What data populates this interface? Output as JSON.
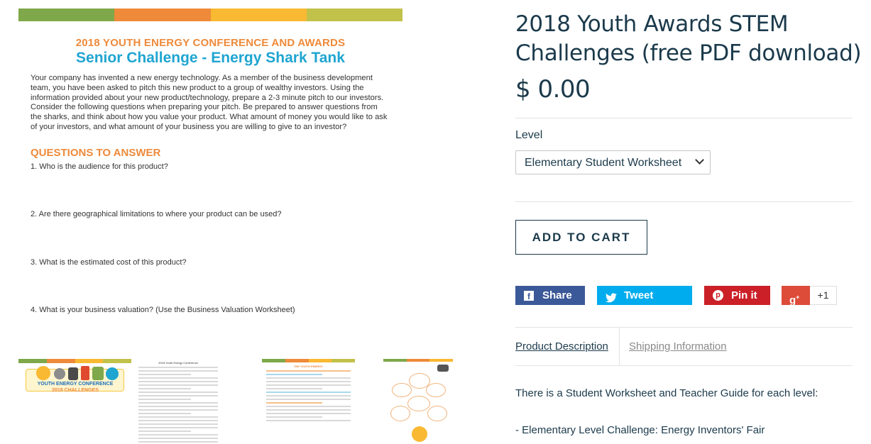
{
  "document_preview": {
    "stripe_colors": [
      "#7ea84a",
      "#ee8a3a",
      "#f9b932",
      "#c1c24a"
    ],
    "heading": "2018 YOUTH ENERGY CONFERENCE AND AWARDS",
    "subheading": "Senior Challenge - Energy Shark Tank",
    "body": "Your company has invented a new energy technology.  As a member of the business development team, you have been asked to pitch this new product to a group of wealthy investors.  Using the information provided about your new product/technology, prepare a 2-3 minute pitch to our investors.  Consider the following questions when preparing your pitch.  Be prepared to answer questions from the sharks, and think about how you value your product.  What amount of money you would like to ask of your investors, and what amount of your business you are willing to give to an investor?",
    "questions_heading": "QUESTIONS TO ANSWER",
    "questions": [
      "1.   Who is the audience for this product?",
      "2.   Are there geographical limitations to where your product can be used?",
      "3.   What is the estimated cost of this product?",
      "4.   What is your business valuation? (Use the Business Valuation Worksheet)"
    ]
  },
  "thumbnails": [
    {
      "line1": "YOUTH ENERGY CONFERENCE",
      "line2": "2018 CHALLENGES"
    },
    {
      "title": "2018 Youth Energy Conference"
    },
    {
      "title": "THE YOUTH ENERGY"
    },
    {
      "title": ""
    }
  ],
  "product": {
    "title": "2018 Youth Awards STEM Challenges (free PDF download)",
    "price": "$ 0.00",
    "level_label": "Level",
    "level_selected": "Elementary Student Worksheet",
    "add_to_cart": "ADD TO CART"
  },
  "social": {
    "facebook": "Share",
    "twitter": "Tweet",
    "pinterest": "Pin it",
    "gplus_count": "+1"
  },
  "tabs": {
    "description": "Product Description",
    "shipping": "Shipping Information"
  },
  "description": {
    "line1": "There is a Student Worksheet and Teacher Guide for each level:",
    "line2": "- Elementary Level Challenge: Energy Inventors' Fair"
  }
}
